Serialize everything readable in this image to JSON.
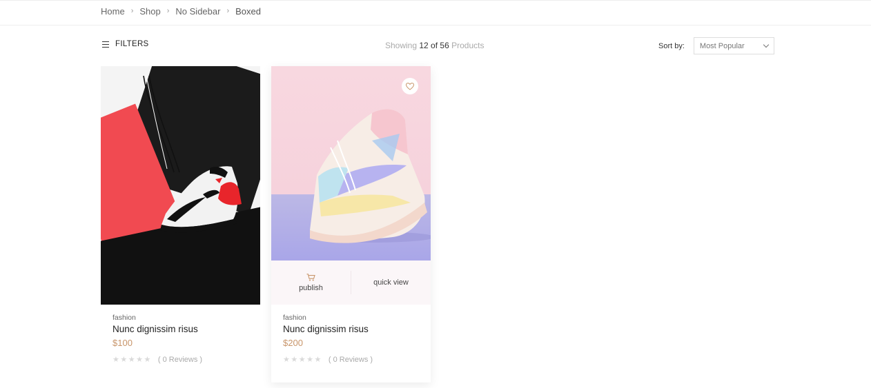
{
  "breadcrumb": {
    "items": [
      "Home",
      "Shop",
      "No Sidebar",
      "Boxed"
    ]
  },
  "toolbar": {
    "filters_label": "FILTERS",
    "showing_prefix": "Showing",
    "showing_count": "12 of 56",
    "showing_suffix": "Products",
    "sort_label": "Sort by:",
    "sort_value": "Most Popular"
  },
  "products": [
    {
      "category": "fashion",
      "name": "Nunc dignissim risus",
      "price": "$100",
      "reviews": "( 0 Reviews )",
      "rating": 0
    },
    {
      "category": "fashion",
      "name": "Nunc dignissim risus",
      "price": "$200",
      "reviews": "( 0 Reviews )",
      "rating": 0,
      "publish_label": "publish",
      "quickview_label": "quick view"
    }
  ],
  "icons": {
    "menu": "hamburger-icon",
    "chevron": "chevron-down-icon",
    "wishlist": "heart-icon",
    "cart": "cart-icon",
    "star": "star-icon"
  },
  "colors": {
    "price": "#c8956a",
    "accent_cart": "#c8956a"
  }
}
